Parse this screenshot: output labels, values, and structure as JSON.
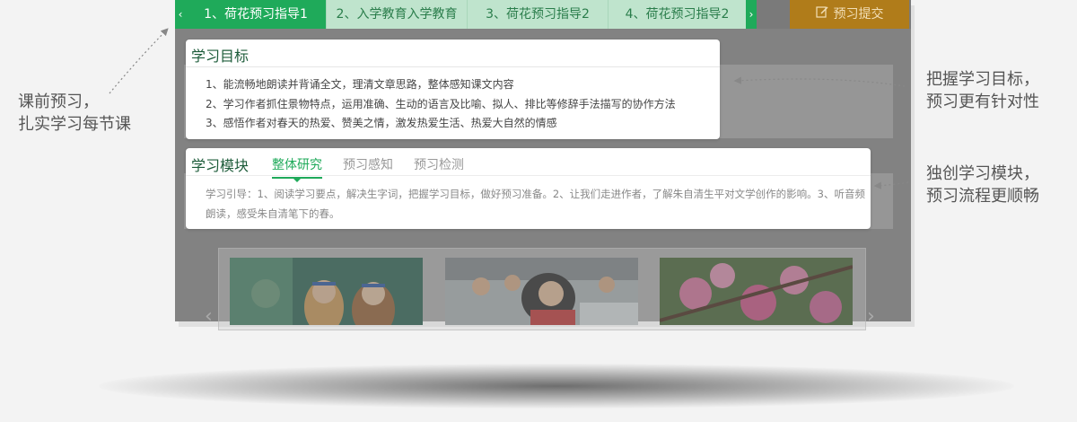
{
  "tabs": {
    "items": [
      {
        "label": "1、荷花预习指导1",
        "active": true
      },
      {
        "label": "2、入学教育入学教育",
        "active": false
      },
      {
        "label": "3、荷花预习指导2",
        "active": false
      },
      {
        "label": "4、荷花预习指导2",
        "active": false
      }
    ],
    "submit_label": "预习提交",
    "prev_icon": "chevron-left-icon",
    "next_icon": "chevron-right-icon"
  },
  "goals": {
    "title": "学习目标",
    "items": [
      "1、能流畅地朗读并背诵全文，理清文章思路，整体感知课文内容",
      "2、学习作者抓住景物特点，运用准确、生动的语言及比喻、拟人、排比等修辞手法描写的协作方法",
      "3、感悟作者对春天的热爱、赞美之情，激发热爱生活、热爱大自然的情感"
    ]
  },
  "module": {
    "title": "学习模块",
    "tabs": [
      {
        "label": "整体研究",
        "active": true
      },
      {
        "label": "预习感知",
        "active": false
      },
      {
        "label": "预习检测",
        "active": false
      }
    ],
    "guide_text": "学习引导：1、阅读学习要点，解决生字词，把握学习目标，做好预习准备。2、让我们走进作者，了解朱自清生平对文学创作的影响。3、听音频朗读，感受朱自清笔下的春。"
  },
  "annotations": {
    "left": [
      "课前预习，",
      "扎实学习每节课"
    ],
    "right_top": [
      "把握学习目标，",
      "预习更有针对性"
    ],
    "right_bottom": [
      "独创学习模块，",
      "预习流程更顺畅"
    ]
  },
  "colors": {
    "accent_green": "#1faa5a",
    "tab_inactive": "#bfe4cd",
    "submit_bg": "#b07c1a",
    "background": "#f3f3f3"
  }
}
